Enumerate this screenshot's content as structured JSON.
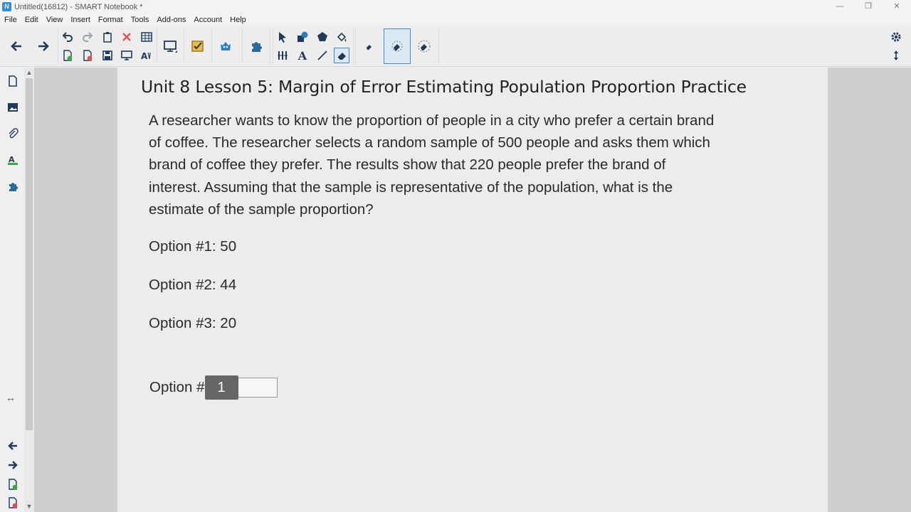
{
  "window": {
    "title": "Untitled(16812) - SMART Notebook *",
    "app_icon_letter": "N",
    "minimize": "—",
    "restore": "❐",
    "close": "✕"
  },
  "menu": [
    "File",
    "Edit",
    "View",
    "Insert",
    "Format",
    "Tools",
    "Add-ons",
    "Account",
    "Help"
  ],
  "toolbar": {
    "accent": "#3d8bd1",
    "text_tool_glyph": "A"
  },
  "sidebar": {
    "split_glyph": "↔",
    "scroll_up": "▲",
    "scroll_down": "▼"
  },
  "page": {
    "title": "Unit 8 Lesson 5:  Margin of Error Estimating Population Proportion Practice",
    "question": "A researcher wants to know the proportion of people in a city who prefer a certain brand of coffee. The researcher selects a random sample of 500 people and asks them which brand of coffee they prefer. The results show that 220 people prefer the brand of interest. Assuming that the sample is representative of the population, what is the estimate of the sample proportion?",
    "options": [
      "Option #1: 50",
      "Option #2: 44",
      "Option #3: 20"
    ],
    "answer_label": "Option #",
    "answer_value": "1"
  }
}
